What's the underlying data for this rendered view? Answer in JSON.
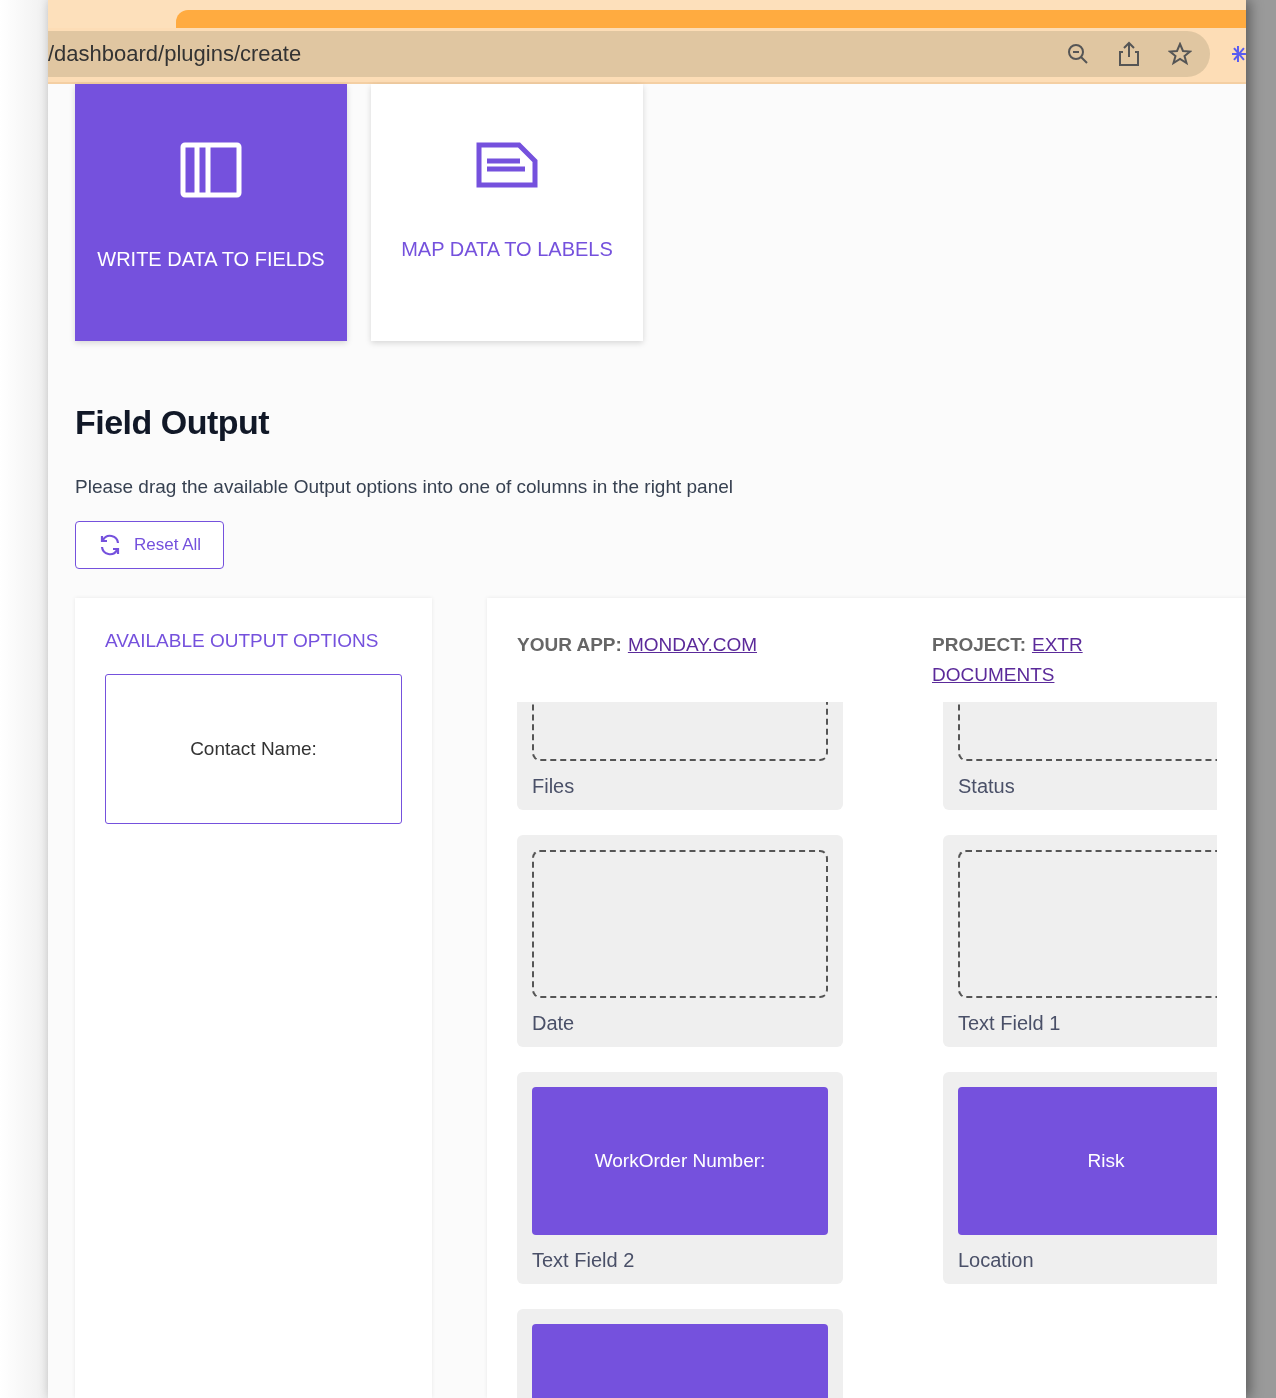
{
  "browser": {
    "url": "/dashboard/plugins/create"
  },
  "modes": [
    {
      "label": "WRITE DATA TO FIELDS",
      "kind": "columns",
      "selected": true
    },
    {
      "label": "MAP DATA TO LABELS",
      "kind": "document",
      "selected": false
    }
  ],
  "section": {
    "title": "Field Output",
    "description": "Please drag the available Output options into one of columns in the right panel",
    "reset_button": "Reset All"
  },
  "available_panel": {
    "title": "AVAILABLE OUTPUT OPTIONS",
    "options": [
      "Contact Name:"
    ]
  },
  "mapping_panel": {
    "app_label": "YOUR APP:",
    "app_link": "MONDAY.COM",
    "project_label": "PROJECT:",
    "project_link": [
      "EXTR",
      "DOCUMENTS"
    ],
    "rows": [
      [
        {
          "kind": "empty",
          "label": "Files"
        },
        {
          "kind": "empty",
          "label": "Status"
        }
      ],
      [
        {
          "kind": "empty",
          "label": "Date"
        },
        {
          "kind": "empty",
          "label": "Text Field 1"
        }
      ],
      [
        {
          "kind": "filled",
          "value": "WorkOrder Number:",
          "label": "Text Field 2"
        },
        {
          "kind": "filled",
          "value": "Risk",
          "label": "Location"
        }
      ],
      [
        {
          "kind": "filled"
        }
      ]
    ]
  }
}
